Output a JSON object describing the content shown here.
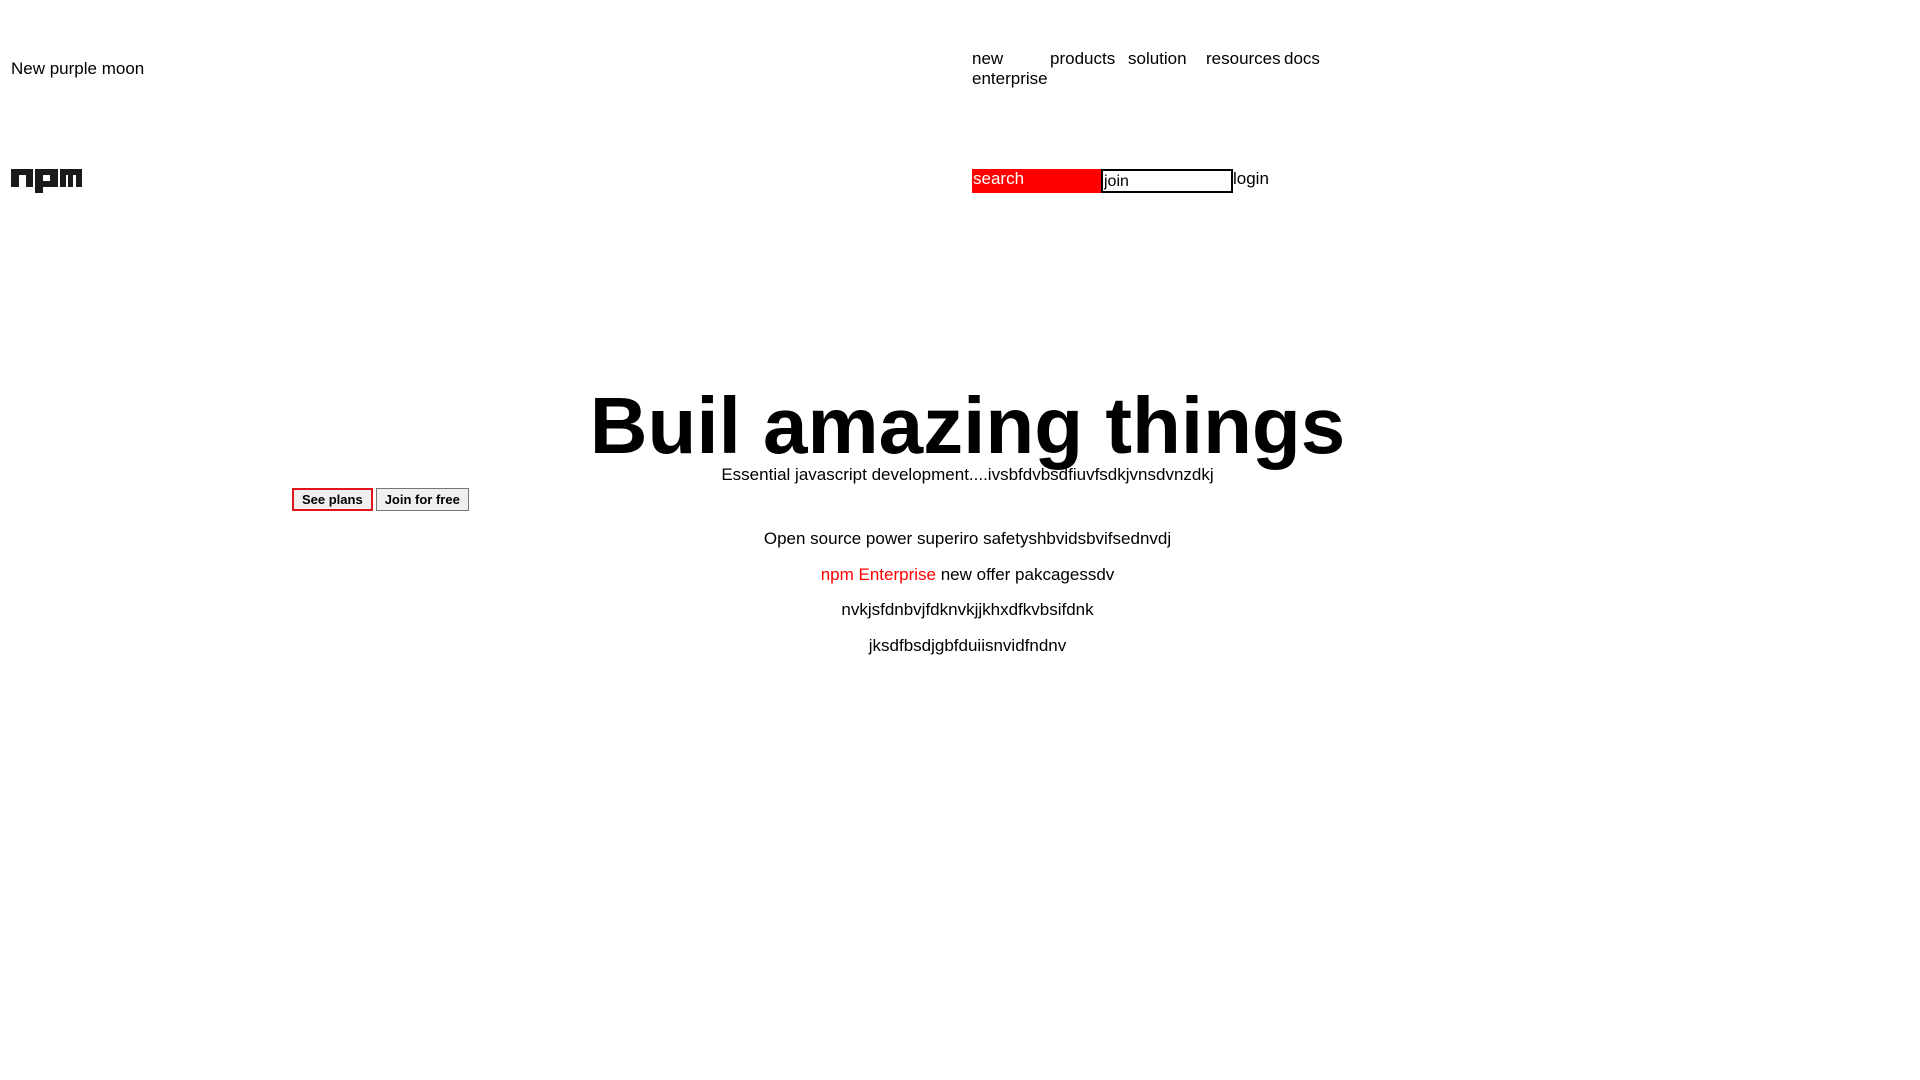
{
  "header": {
    "tagline": "New purple moon",
    "nav": [
      {
        "label": "new enterprise"
      },
      {
        "label": "products"
      },
      {
        "label": "solution"
      },
      {
        "label": "resources"
      },
      {
        "label": "docs"
      }
    ],
    "logo_icon": "npm-logo-icon",
    "search_label": "search",
    "join_value": "join",
    "login_label": "login"
  },
  "hero": {
    "title": "Buil amazing things",
    "subtitle": "Essential javascript development....ivsbfdvbsdfiuvfsdkjvnsdvnzdkj",
    "see_plans_label": "See plans",
    "join_free_label": "Join for free"
  },
  "info": {
    "line1": "Open source power superiro safetyshbvidsbvifsednvdj",
    "enterprise_link": "npm Enterprise",
    "line2_rest": " new offer pakcagessdv",
    "line3": "nvkjsfdnbvjfdknvkjjkhxdfkvbsifdnk",
    "line4": "jksdfbsdjgbfduiisnvidfndnv"
  },
  "colors": {
    "accent": "#ff0000",
    "button_border": "#e0151b"
  }
}
